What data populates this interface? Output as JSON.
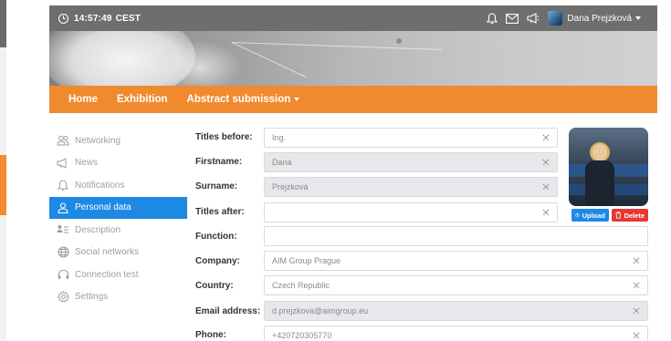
{
  "topbar": {
    "time": "14:57:49",
    "timezone": "CEST",
    "icons": [
      "bell-icon",
      "envelope-icon",
      "megaphone-icon"
    ],
    "user_name": "Dana Prejzková"
  },
  "nav": {
    "items": [
      {
        "label": "Home"
      },
      {
        "label": "Exhibition"
      },
      {
        "label": "Abstract submission"
      }
    ]
  },
  "sidebar": {
    "items": [
      {
        "label": "Networking",
        "icon": "users-icon"
      },
      {
        "label": "News",
        "icon": "megaphone-icon"
      },
      {
        "label": "Notifications",
        "icon": "bell-icon"
      },
      {
        "label": "Personal data",
        "icon": "user-icon",
        "active": true
      },
      {
        "label": "Description",
        "icon": "id-card-icon"
      },
      {
        "label": "Social networks",
        "icon": "globe-icon"
      },
      {
        "label": "Connection test",
        "icon": "headset-icon"
      },
      {
        "label": "Settings",
        "icon": "gear-icon"
      }
    ]
  },
  "form": {
    "fields": [
      {
        "label": "Titles before:",
        "value": "Ing."
      },
      {
        "label": "Firstname:",
        "value": "Dana"
      },
      {
        "label": "Surname:",
        "value": "Prejzková"
      },
      {
        "label": "Titles after:",
        "value": ""
      },
      {
        "label": "Function:",
        "value": ""
      },
      {
        "label": "Company:",
        "value": "AIM Group Prague"
      },
      {
        "label": "Country:",
        "value": "Czech Republic"
      },
      {
        "label": "Email address:",
        "value": "d.prejzkova@aimgroup.eu"
      },
      {
        "label": "Phone:",
        "value": "+420720305770"
      }
    ]
  },
  "photo": {
    "upload_label": "Upload",
    "delete_label": "Delete"
  },
  "colors": {
    "nav_orange": "#f08a2f",
    "active_blue": "#1e88e5",
    "delete_red": "#e53935",
    "topbar_grey": "#6e6e6e"
  }
}
